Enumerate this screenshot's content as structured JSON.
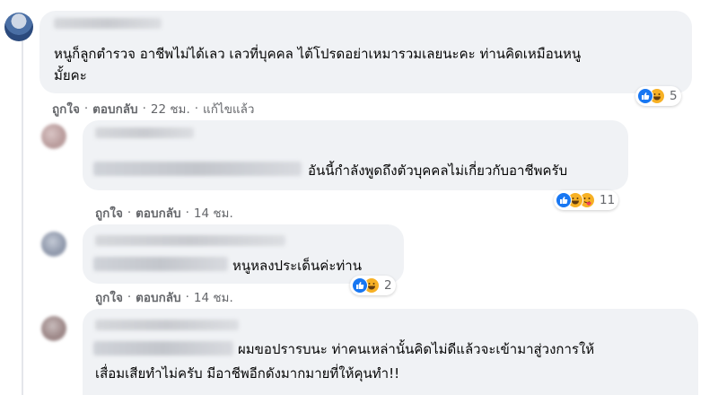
{
  "comments": [
    {
      "text_line1": "หนูก็ลูกตำรวจ อาชีพไม่ได้เลว เลวที่บุคคล ไต้โปรดอย่าเหมารวมเลยนะคะ ท่านคิดเหมือนหนู",
      "text_line2": "มั้ยคะ",
      "actions": {
        "like": "ถูกใจ",
        "reply": "ตอบกลับ",
        "time": "22 ชม.",
        "edited": "แก้ไขแล้ว"
      },
      "reaction_count": "5"
    },
    {
      "text": "อันนี้กำลังพูดถึงตัวบุคคลไม่เกี่ยวกับอาชีพครับ",
      "actions": {
        "like": "ถูกใจ",
        "reply": "ตอบกลับ",
        "time": "14 ชม."
      },
      "reaction_count": "11"
    },
    {
      "text": "หนูหลงประเด็นค่ะท่าน",
      "actions": {
        "like": "ถูกใจ",
        "reply": "ตอบกลับ",
        "time": "14 ชม."
      },
      "reaction_count": "2"
    },
    {
      "text_line1": "ผมขอปรารบนะ ท่าคนเหล่านั้นคิดไม่ดีแล้วจะเข้ามาสู่วงการให้",
      "text_line2": "เสื่อมเสียทำไม่ครับ มีอาชีพอีกดังมากมายที่ให้คุนทำ!!"
    }
  ],
  "reaction_icons": [
    "like-icon",
    "haha-icon",
    "care-icon"
  ],
  "colors": {
    "like": "#1877f2",
    "haha": "#f7b125",
    "bubble": "#f0f2f5",
    "meta": "#65676b"
  }
}
